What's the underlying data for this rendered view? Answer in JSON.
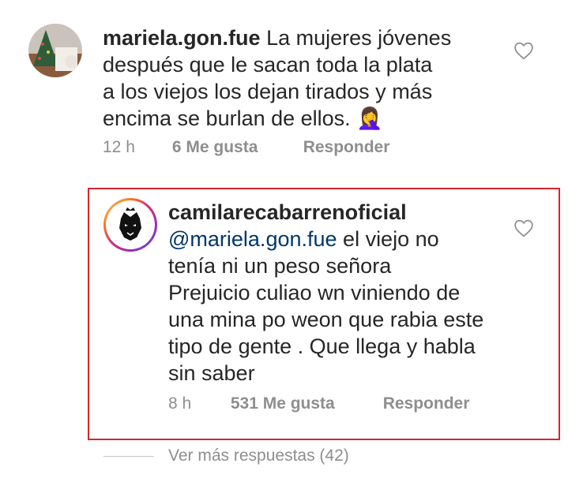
{
  "comment1": {
    "username": "mariela.gon.fue",
    "text_lines": [
      "La mujeres jóvenes",
      "después que le sacan toda la plata",
      "a los viejos los dejan tirados y más",
      "encima se burlan de ellos. 🤦‍♀"
    ],
    "time": "12 h",
    "likes": "6 Me gusta",
    "reply": "Responder",
    "icons": {
      "avatar": "christmas-tree-photo",
      "like": "heart-outline-icon"
    }
  },
  "comment2": {
    "username": "camilarecabarrenoficial",
    "mention": "@mariela.gon.fue",
    "text_lines": [
      "el viejo no",
      "tenía ni un peso señora",
      "Prejuicio culiao wn viniendo de",
      "una mina po weon que rabia este",
      "tipo de gente . Que llega y habla",
      "sin saber"
    ],
    "time": "8 h",
    "likes": "531 Me gusta",
    "reply": "Responder",
    "icons": {
      "avatar": "panther-logo",
      "like": "heart-outline-icon"
    }
  },
  "more_replies": "Ver más respuestas (42)",
  "colors": {
    "highlight": "#d7252c",
    "mention": "#00376b",
    "meta": "#8e8e8e"
  }
}
